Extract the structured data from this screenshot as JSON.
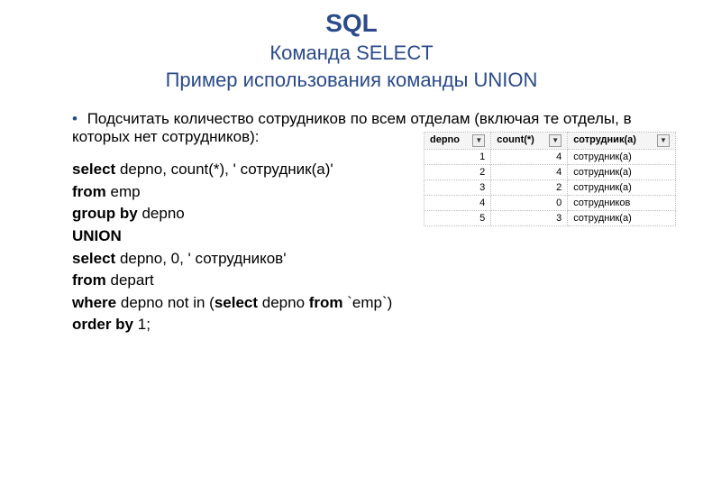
{
  "title": {
    "main": "SQL",
    "sub1": "Команда SELECT",
    "sub2": "Пример использования команды UNION"
  },
  "bullet": "Подсчитать количество сотрудников по всем отделам (включая те отделы, в которых нет сотрудников):",
  "code": {
    "l1a": "select ",
    "l1b": "depno, count(*), ' сотрудник(а)'",
    "l2a": "from ",
    "l2b": "emp",
    "l3a": "group by ",
    "l3b": "depno",
    "l4": "UNION",
    "l5a": "select ",
    "l5b": "depno, 0, ' сотрудников'",
    "l6a": "from ",
    "l6b": "depart",
    "l7a": "where ",
    "l7b": "depno not in (",
    "l7c": "select ",
    "l7d": "depno ",
    "l7e": "from ",
    "l7f": "`emp`)",
    "l8a": "order by ",
    "l8b": "1;"
  },
  "table": {
    "headers": [
      "depno",
      "count(*)",
      "сотрудник(а)"
    ],
    "rows": [
      {
        "depno": "1",
        "count": "4",
        "label": "сотрудник(а)"
      },
      {
        "depno": "2",
        "count": "4",
        "label": "сотрудник(а)"
      },
      {
        "depno": "3",
        "count": "2",
        "label": "сотрудник(а)"
      },
      {
        "depno": "4",
        "count": "0",
        "label": "сотрудников"
      },
      {
        "depno": "5",
        "count": "3",
        "label": "сотрудник(а)"
      }
    ]
  }
}
